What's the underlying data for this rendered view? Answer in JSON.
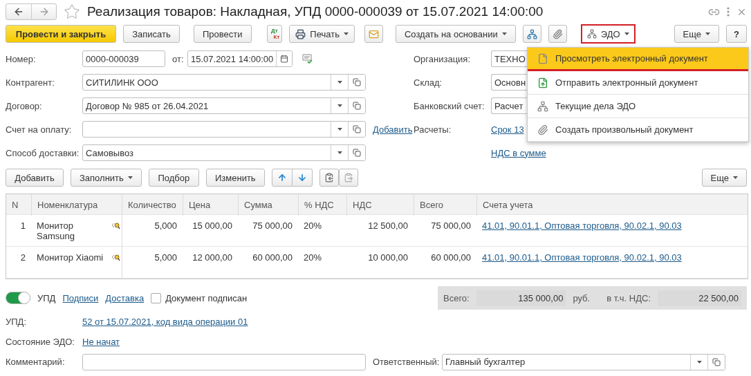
{
  "title": "Реализация товаров: Накладная, УПД 0000-000039 от 15.07.2021 14:00:00",
  "toolbar": {
    "post_close": "Провести и закрыть",
    "save": "Записать",
    "post": "Провести",
    "dtkt": {
      "top": "Дт",
      "bottom": "Кт"
    },
    "print": "Печать",
    "create_based": "Создать на основании",
    "edo": "ЭДО",
    "more": "Еще",
    "help": "?"
  },
  "edo_menu": [
    {
      "kind": "view",
      "label": "Просмотреть электронный документ",
      "selected": true
    },
    {
      "kind": "send",
      "label": "Отправить электронный документ",
      "selected": false
    },
    {
      "kind": "tasks",
      "label": "Текущие дела ЭДО",
      "selected": false
    },
    {
      "kind": "attach",
      "label": "Создать произвольный документ",
      "selected": false
    }
  ],
  "number": {
    "label": "Номер:",
    "value": "0000-000039",
    "date_label": "от:",
    "date": "15.07.2021 14:00:00"
  },
  "left_fields": [
    {
      "label": "Контрагент:",
      "value": "СИТИЛИНК ООО"
    },
    {
      "label": "Договор:",
      "value": "Договор № 985 от 26.04.2021"
    },
    {
      "label": "Счет на оплату:",
      "link": "Добавить"
    },
    {
      "label": "Способ доставки:",
      "value": "Самовывоз"
    }
  ],
  "right_fields": [
    {
      "kind": "field",
      "label": "Организация:",
      "value": "ТЕХНО"
    },
    {
      "kind": "field",
      "label": "Склад:",
      "value": "Основн"
    },
    {
      "kind": "field",
      "label": "Банковский счет:",
      "value": "Расчет"
    },
    {
      "kind": "link",
      "label": "Расчеты:",
      "value": "Срок 13"
    },
    {
      "kind": "link",
      "value": "НДС в сумме"
    }
  ],
  "table_toolbar": {
    "add": "Добавить",
    "fill": "Заполнить",
    "pick": "Подбор",
    "change": "Изменить",
    "more": "Еще"
  },
  "table": {
    "columns": [
      "N",
      "Номенклатура",
      "Количество",
      "Цена",
      "Сумма",
      "% НДС",
      "НДС",
      "Всего",
      "Счета учета"
    ],
    "rows": [
      {
        "n": "1",
        "item": "Монитор Samsung",
        "qty": "5,000",
        "price": "15 000,00",
        "sum": "75 000,00",
        "vat_rate": "20%",
        "vat": "12 500,00",
        "total": "75 000,00",
        "accounts": "41.01, 90.01.1, Оптовая торговля, 90.02.1, 90.03"
      },
      {
        "n": "2",
        "item": "Монитор Xiaomi",
        "qty": "5,000",
        "price": "12 000,00",
        "sum": "60 000,00",
        "vat_rate": "20%",
        "vat": "10 000,00",
        "total": "60 000,00",
        "accounts": "41.01, 90.01.1, Оптовая торговля, 90.02.1, 90.03"
      }
    ]
  },
  "upd_toggle": {
    "label": "УПД",
    "on": true
  },
  "links": [
    "Подписи",
    "Доставка"
  ],
  "signed": {
    "label": "Документ подписан",
    "checked": false
  },
  "totals": {
    "label": "Всего:",
    "value": "135 000,00",
    "currency": "руб.",
    "vat_label": "в т.ч. НДС:",
    "vat": "22 500,00"
  },
  "upd": {
    "label": "УПД:",
    "link": "52 от 15.07.2021, код вида операции 01"
  },
  "edo_state": {
    "label": "Состояние ЭДО:",
    "link": "Не начат"
  },
  "comment": {
    "label": "Комментарий:"
  },
  "responsible": {
    "label": "Ответственный:",
    "value": "Главный бухгалтер"
  }
}
